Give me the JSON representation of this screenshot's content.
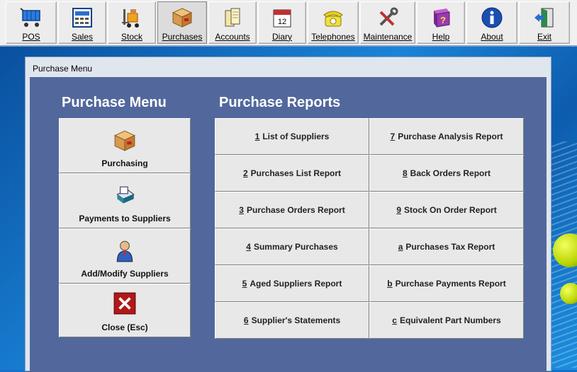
{
  "toolbar": {
    "items": [
      {
        "label": "POS",
        "icon": "shopping-cart-icon"
      },
      {
        "label": "Sales",
        "icon": "sales-register-icon"
      },
      {
        "label": "Stock",
        "icon": "forklift-icon"
      },
      {
        "label": "Purchases",
        "icon": "package-box-icon"
      },
      {
        "label": "Accounts",
        "icon": "ledger-books-icon"
      },
      {
        "label": "Diary",
        "icon": "calendar-icon"
      },
      {
        "label": "Telephones",
        "icon": "telephone-icon"
      },
      {
        "label": "Maintenance",
        "icon": "tools-icon"
      },
      {
        "label": "Help",
        "icon": "help-book-icon"
      },
      {
        "label": "About",
        "icon": "info-icon"
      },
      {
        "label": "Exit",
        "icon": "exit-door-icon"
      }
    ],
    "active": "Purchases"
  },
  "window": {
    "title": "Purchase Menu"
  },
  "purchase_menu": {
    "heading": "Purchase Menu",
    "buttons": [
      {
        "label": "Purchasing",
        "icon": "package-box-icon"
      },
      {
        "label": "Payments to Suppliers",
        "icon": "printer-payment-icon"
      },
      {
        "label": "Add/Modify Suppliers",
        "icon": "supplier-person-icon"
      },
      {
        "label": "Close  (Esc)",
        "icon": "close-x-icon"
      }
    ]
  },
  "purchase_reports": {
    "heading": "Purchase Reports",
    "left": [
      {
        "key": "1",
        "label": "List of Suppliers"
      },
      {
        "key": "2",
        "label": "Purchases List Report"
      },
      {
        "key": "3",
        "label": "Purchase Orders Report"
      },
      {
        "key": "4",
        "label": "Summary Purchases"
      },
      {
        "key": "5",
        "label": "Aged Suppliers Report"
      },
      {
        "key": "6",
        "label": "Supplier's Statements"
      }
    ],
    "right": [
      {
        "key": "7",
        "label": "Purchase Analysis Report"
      },
      {
        "key": "8",
        "label": "Back Orders Report"
      },
      {
        "key": "9",
        "label": "Stock On Order Report"
      },
      {
        "key": "a",
        "label": "Purchases Tax Report"
      },
      {
        "key": "b",
        "label": "Purchase Payments Report"
      },
      {
        "key": "c",
        "label": "Equivalent Part Numbers"
      }
    ]
  },
  "colors": {
    "panel": "#52689c",
    "toolbar": "#ececec",
    "close_red": "#b01818"
  }
}
